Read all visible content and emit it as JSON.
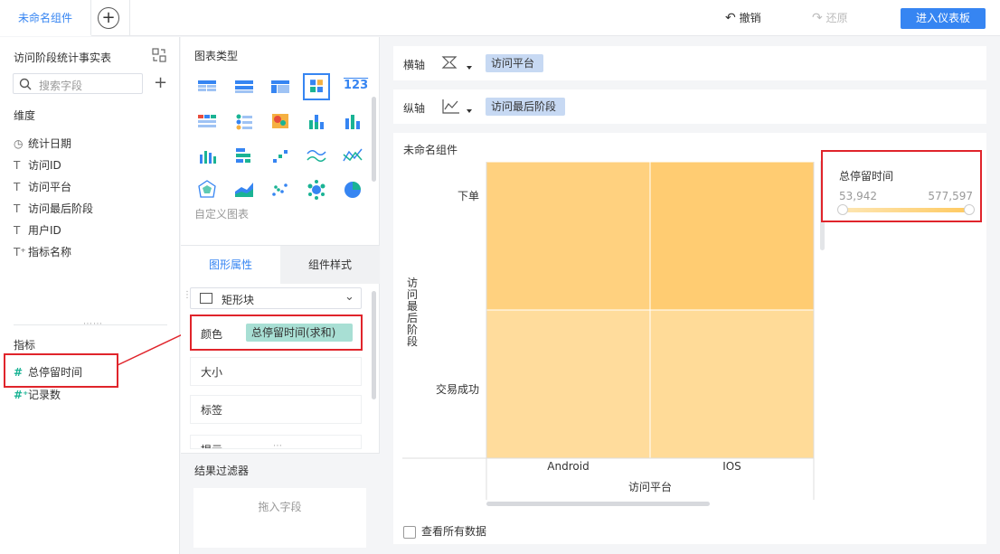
{
  "topbar": {
    "tab_label": "未命名组件",
    "add_tab": "+",
    "undo": "撤销",
    "redo": "还原",
    "enter_dashboard": "进入仪表板"
  },
  "left_panel": {
    "dataset_title": "访问阶段统计事实表",
    "search_placeholder": "搜索字段",
    "dimension_title": "维度",
    "dimensions": [
      {
        "icon": "clock-icon",
        "glyph": "◷",
        "label": "统计日期"
      },
      {
        "icon": "text-icon",
        "glyph": "T",
        "label": "访问ID"
      },
      {
        "icon": "text-icon",
        "glyph": "T",
        "label": "访问平台"
      },
      {
        "icon": "text-icon",
        "glyph": "T",
        "label": "访问最后阶段"
      },
      {
        "icon": "text-icon",
        "glyph": "T",
        "label": "用户ID"
      },
      {
        "icon": "text-plus-icon",
        "glyph": "T⁺",
        "label": "指标名称"
      }
    ],
    "indicator_title": "指标",
    "indicators": [
      {
        "icon": "hash-icon",
        "glyph": "#",
        "label": "总停留时间"
      },
      {
        "icon": "hash-plus-icon",
        "glyph": "#⁺",
        "label": "记录数"
      }
    ]
  },
  "middle_panel": {
    "chart_type_title": "图表类型",
    "custom_chart": "自定义图表",
    "tabs": [
      "图形属性",
      "组件样式"
    ],
    "mark_type": "矩形块",
    "color_label": "颜色",
    "color_field": "总停留时间(求和)",
    "size_label": "大小",
    "label_label": "标签",
    "tooltip_label": "提示",
    "filter_title": "结果过滤器",
    "filter_drop": "拖入字段"
  },
  "axes": {
    "x_label": "横轴",
    "x_field": "访问平台",
    "y_label": "纵轴",
    "y_field": "访问最后阶段"
  },
  "chart": {
    "title": "未命名组件",
    "show_all": "查看所有数据",
    "legend": {
      "title": "总停留时间",
      "min": "53,942",
      "max": "577,597",
      "min_color": "#fde6b3",
      "max_color": "#ffc95f"
    }
  },
  "chart_data": {
    "type": "heatmap",
    "title": "未命名组件",
    "xlabel": "访问平台",
    "ylabel": "访问最后阶段",
    "x_categories": [
      "Android",
      "IOS"
    ],
    "y_categories": [
      "下单",
      "交易成功"
    ],
    "cells": [
      {
        "x": "Android",
        "y": "下单",
        "color": "#ffd17f"
      },
      {
        "x": "IOS",
        "y": "下单",
        "color": "#ffcc72"
      },
      {
        "x": "Android",
        "y": "交易成功",
        "color": "#ffdc9c"
      },
      {
        "x": "IOS",
        "y": "交易成功",
        "color": "#ffdb98"
      }
    ],
    "color_range": [
      53942,
      577597
    ]
  }
}
